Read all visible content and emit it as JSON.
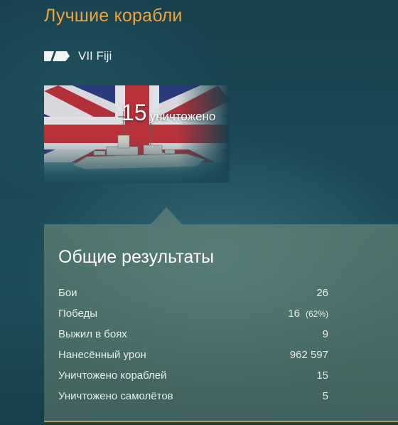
{
  "header": {
    "title": "Лучшие корабли"
  },
  "ship": {
    "tier_name": "VII Fiji",
    "class_icon": "cruiser-class-icon",
    "kills_count": "15",
    "kills_label": "уничтожено"
  },
  "stats": {
    "title": "Общие результаты",
    "rows": [
      {
        "label": "Бои",
        "value": "26",
        "percent": ""
      },
      {
        "label": "Победы",
        "value": "16",
        "percent": "(62%)"
      },
      {
        "label": "Выжил в боях",
        "value": "9",
        "percent": ""
      },
      {
        "label": "Нанесённый урон",
        "value": "962 597",
        "percent": ""
      },
      {
        "label": "Уничтожено кораблей",
        "value": "15",
        "percent": ""
      },
      {
        "label": "Уничтожено самолётов",
        "value": "5",
        "percent": ""
      }
    ]
  },
  "colors": {
    "title": "#f0a33b",
    "accent_line": "#b79a55"
  }
}
